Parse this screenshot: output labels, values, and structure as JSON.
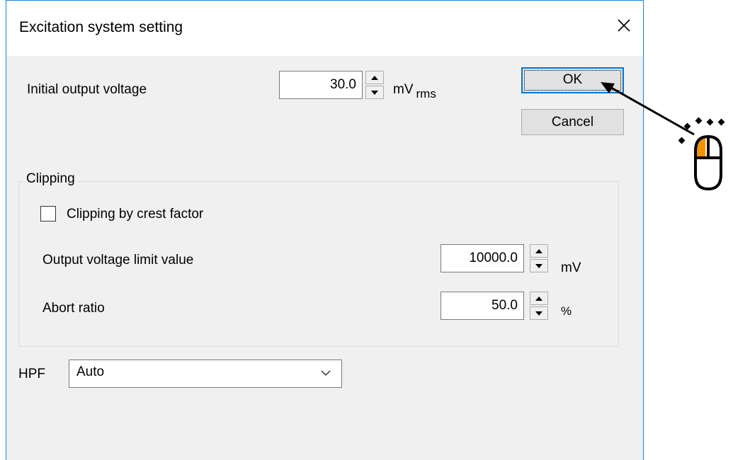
{
  "window": {
    "title": "Excitation system setting",
    "close_glyph": "✕"
  },
  "initial_voltage": {
    "label": "Initial output voltage",
    "value": "30.0",
    "unit": "mV",
    "unit_sub": "rms"
  },
  "buttons": {
    "ok": "OK",
    "cancel": "Cancel"
  },
  "clipping": {
    "group_label": "Clipping",
    "checkbox_label": "Clipping by crest factor",
    "checked": false,
    "limit": {
      "label": "Output voltage limit value",
      "value": "10000.0",
      "unit": "mV"
    },
    "abort": {
      "label": "Abort ratio",
      "value": "50.0",
      "unit": "%"
    }
  },
  "hpf": {
    "label": "HPF",
    "selected": "Auto"
  },
  "icons": {
    "mouse": "mouse-left-click-icon",
    "arrow": "pointer-arrow-icon"
  },
  "colors": {
    "accent": "#0078d7",
    "mouse_highlight": "#f39200"
  }
}
